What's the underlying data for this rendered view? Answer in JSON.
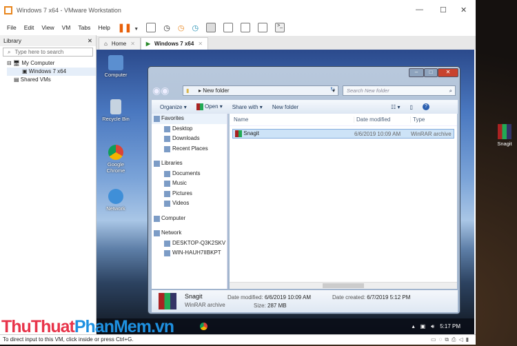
{
  "window": {
    "title": "Windows 7 x64 - VMware Workstation"
  },
  "menu": [
    "File",
    "Edit",
    "View",
    "VM",
    "Tabs",
    "Help"
  ],
  "library": {
    "title": "Library",
    "search_placeholder": "Type here to search",
    "tree": [
      "My Computer",
      "Windows 7 x64",
      "Shared VMs"
    ]
  },
  "tabs": [
    {
      "label": "Home"
    },
    {
      "label": "Windows 7 x64"
    }
  ],
  "desktop_icons": [
    "Computer",
    "Recycle Bin",
    "Google Chrome",
    "Network"
  ],
  "host_icon": "Snagit",
  "explorer": {
    "address": "New folder",
    "search_placeholder": "Search New folder",
    "toolbar": [
      "Organize",
      "Open",
      "Share with",
      "New folder"
    ],
    "nav": [
      {
        "label": "Favorites",
        "h": true
      },
      {
        "label": "Desktop"
      },
      {
        "label": "Downloads"
      },
      {
        "label": "Recent Places"
      },
      {
        "label": "",
        "gap": true
      },
      {
        "label": "Libraries",
        "h": true
      },
      {
        "label": "Documents"
      },
      {
        "label": "Music"
      },
      {
        "label": "Pictures"
      },
      {
        "label": "Videos"
      },
      {
        "label": "",
        "gap": true
      },
      {
        "label": "Computer",
        "h": true
      },
      {
        "label": "",
        "gap": true
      },
      {
        "label": "Network",
        "h": true
      },
      {
        "label": "DESKTOP-Q3K2SKV"
      },
      {
        "label": "WIN-HAUH7IIBKPT"
      }
    ],
    "columns": [
      "Name",
      "Date modified",
      "Type"
    ],
    "file": {
      "name": "Snagit",
      "date": "6/6/2019 10:09 AM",
      "type": "WinRAR archive"
    },
    "details": {
      "name": "Snagit",
      "type": "WinRAR archive",
      "date_modified_label": "Date modified:",
      "date_modified": "6/6/2019 10:09 AM",
      "size_label": "Size:",
      "size": "287 MB",
      "date_created_label": "Date created:",
      "date_created": "6/7/2019 5:12 PM"
    }
  },
  "guest_clock": "5:17 PM",
  "status": "To direct input to this VM, click inside or press Ctrl+G.",
  "watermark": {
    "a": "ThuThuat",
    "b": "PhanMem",
    "c": ".vn"
  }
}
